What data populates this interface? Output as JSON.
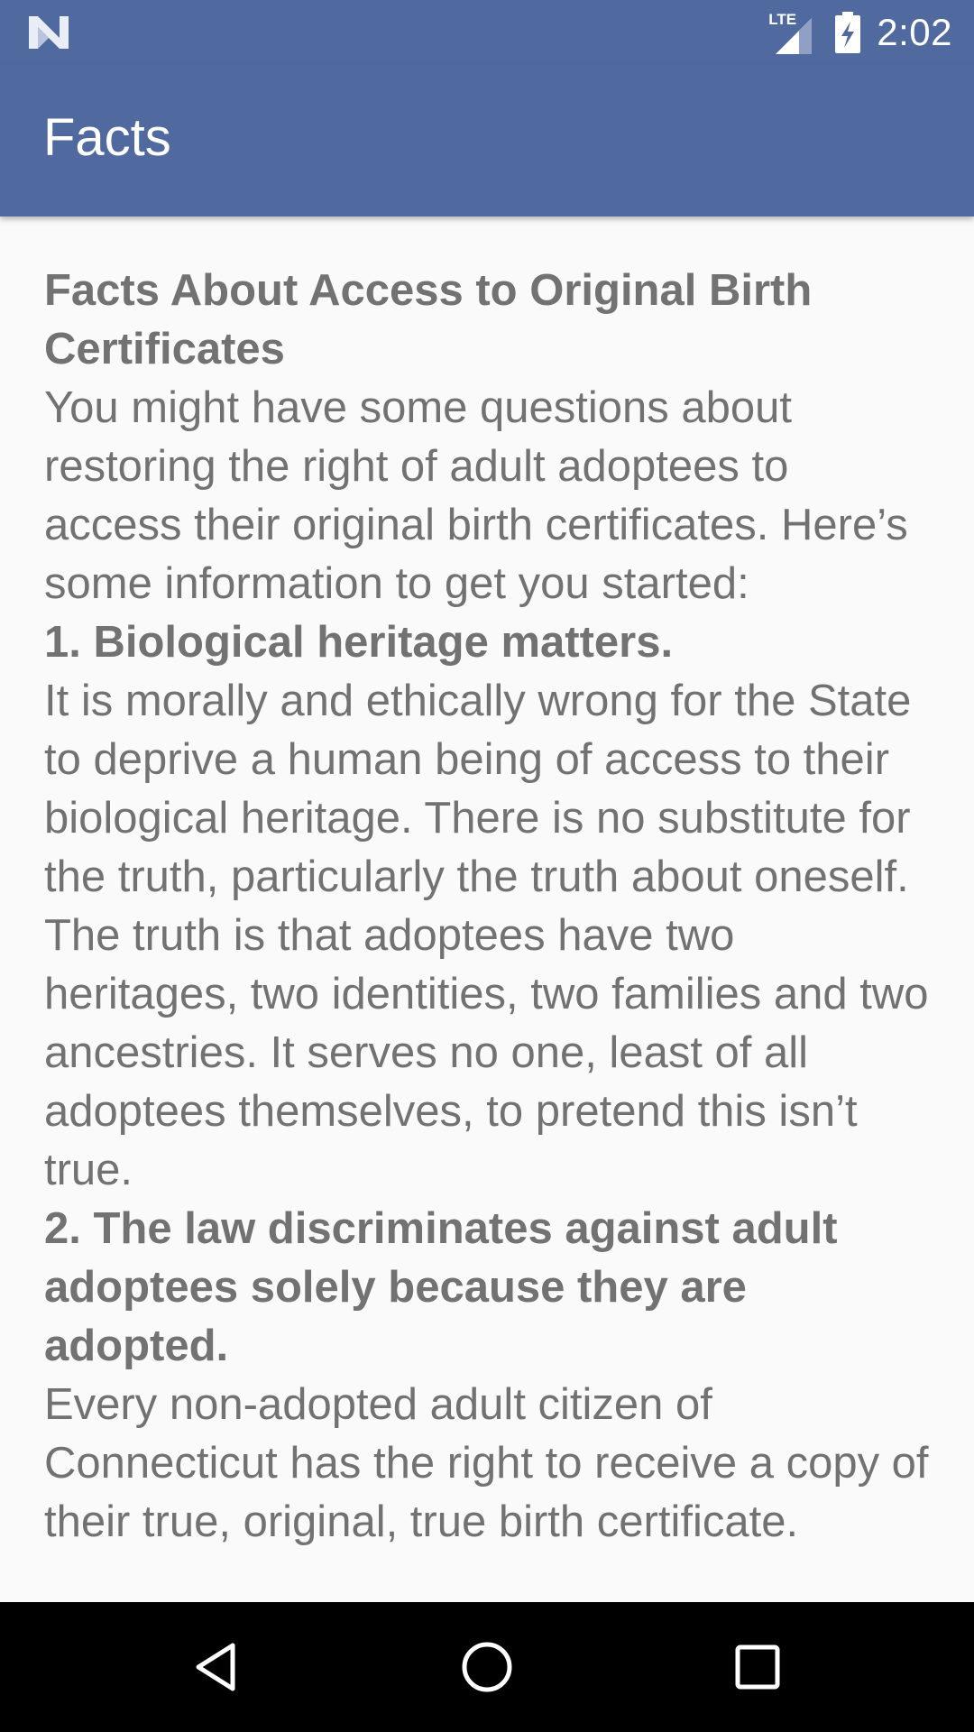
{
  "status_bar": {
    "network": "LTE",
    "time": "2:02",
    "icons": [
      "n-logo-icon",
      "signal-icon",
      "battery-icon"
    ]
  },
  "app_bar": {
    "title": "Facts"
  },
  "content": {
    "heading": "Facts About Access to Original Birth Certificates",
    "intro": "You might have some questions about restoring the right of adult adoptees to access their original birth certificates. Here’s some information to get you started:",
    "fact1_heading": "1. Biological heritage matters.",
    "fact1_body": "It is morally and ethically wrong for the State to deprive a human being of access to their biological heritage. There is no substitute for the truth, particularly the truth about oneself. The truth is that adoptees have two heritages, two identities, two families and two ancestries. It serves no one, least of all adoptees themselves, to pretend this isn’t true.",
    "fact2_heading": "2. The law discriminates against adult adoptees solely because they are adopted.",
    "fact2_body": "Every non-adopted adult citizen of Connecticut has the right to receive a copy of their true, original, true birth certificate."
  },
  "nav_bar": {
    "icons": [
      "back-icon",
      "home-icon",
      "recents-icon"
    ]
  },
  "colors": {
    "primary": "#506aa0",
    "text": "#727272",
    "background": "#fafafa"
  }
}
